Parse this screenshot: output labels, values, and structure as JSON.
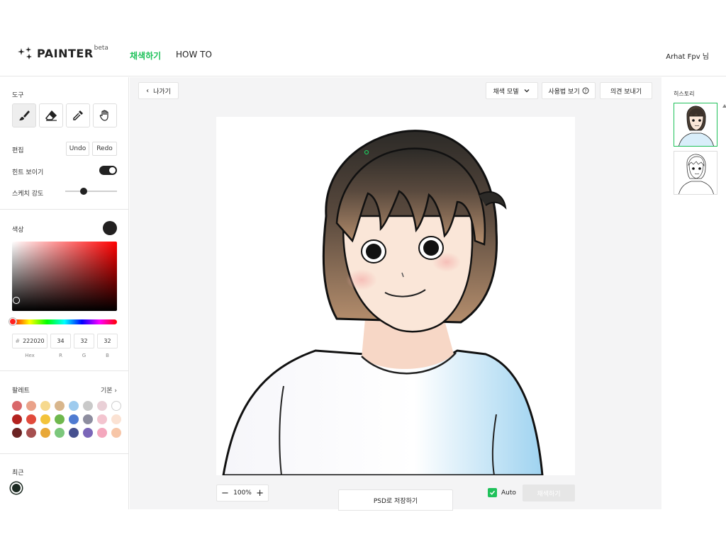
{
  "header": {
    "logo_text": "PAINTER",
    "logo_beta": "beta",
    "nav": [
      {
        "label": "채색하기"
      },
      {
        "label": "HOW TO"
      }
    ],
    "user": "Arhat Fpv 님"
  },
  "sidebar": {
    "tools_label": "도구",
    "edit_label": "편집",
    "undo": "Undo",
    "redo": "Redo",
    "hint_label": "힌트 보이기",
    "hint_on": true,
    "sketch_label": "스케치 강도",
    "sketch_strength": 0.35,
    "color_label": "색상",
    "current_color": "#222020",
    "hex_prefix": "#",
    "hex": "222020",
    "r": "34",
    "g": "32",
    "b": "32",
    "hex_label": "Hex",
    "r_label": "R",
    "g_label": "G",
    "b_label": "B",
    "palette_label": "팔레트",
    "palette_more": "기본",
    "palette_rows": [
      [
        "#d9676a",
        "#eaa28a",
        "#f6d98e",
        "#d8b68c",
        "#9ecbee",
        "#c9c9c9",
        "#e9cfd6",
        "#ffffff"
      ],
      [
        "#b3221f",
        "#e14a3c",
        "#f3c33a",
        "#6fb84d",
        "#4f7bd1",
        "#8d8d9f",
        "#f3c4cf",
        "#fbe2d3"
      ],
      [
        "#6b2323",
        "#a64f4f",
        "#e8a838",
        "#7cc77c",
        "#46508f",
        "#7a66b8",
        "#f4a7bd",
        "#f7c6a8"
      ]
    ],
    "recent_label": "최근",
    "recent_color": "#1c2a22"
  },
  "main": {
    "exit": "나가기",
    "model": "채색 모델",
    "howto": "사용법 보기",
    "feedback": "의견 보내기",
    "zoom": "100%",
    "psd": "PSD로 저장하기",
    "auto": "Auto",
    "auto_checked": true,
    "colorize": "채색하기"
  },
  "history": {
    "label": "히스토리"
  }
}
